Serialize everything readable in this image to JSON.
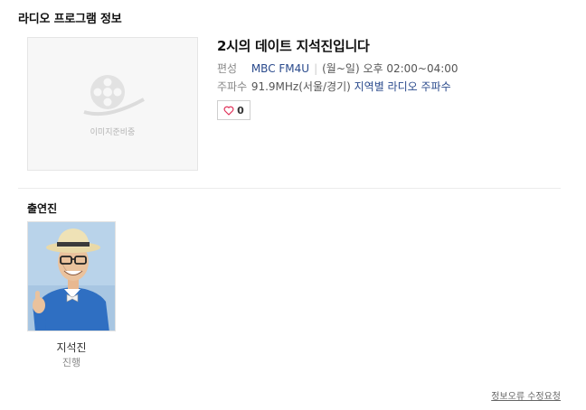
{
  "section_title": "라디오 프로그램 정보",
  "program": {
    "no_image_text": "이미지준비중",
    "title": "2시의 데이트 지석진입니다",
    "channel_label": "편성",
    "channel": "MBC FM4U",
    "schedule": "(월~일) 오후 02:00~04:00",
    "frequency_label": "주파수",
    "frequency": "91.9MHz(서울/경기)",
    "regional_link": "지역별 라디오 주파수",
    "like_count": "0"
  },
  "cast": {
    "title": "출연진",
    "members": [
      {
        "name": "지석진",
        "role": "진행"
      }
    ]
  },
  "report_link": "정보오류 수정요청",
  "colors": {
    "link_blue": "#2a4a8c",
    "heart": "#e0335a",
    "photo_bg": "#b9d3ea",
    "shirt": "#2f6fc2"
  }
}
